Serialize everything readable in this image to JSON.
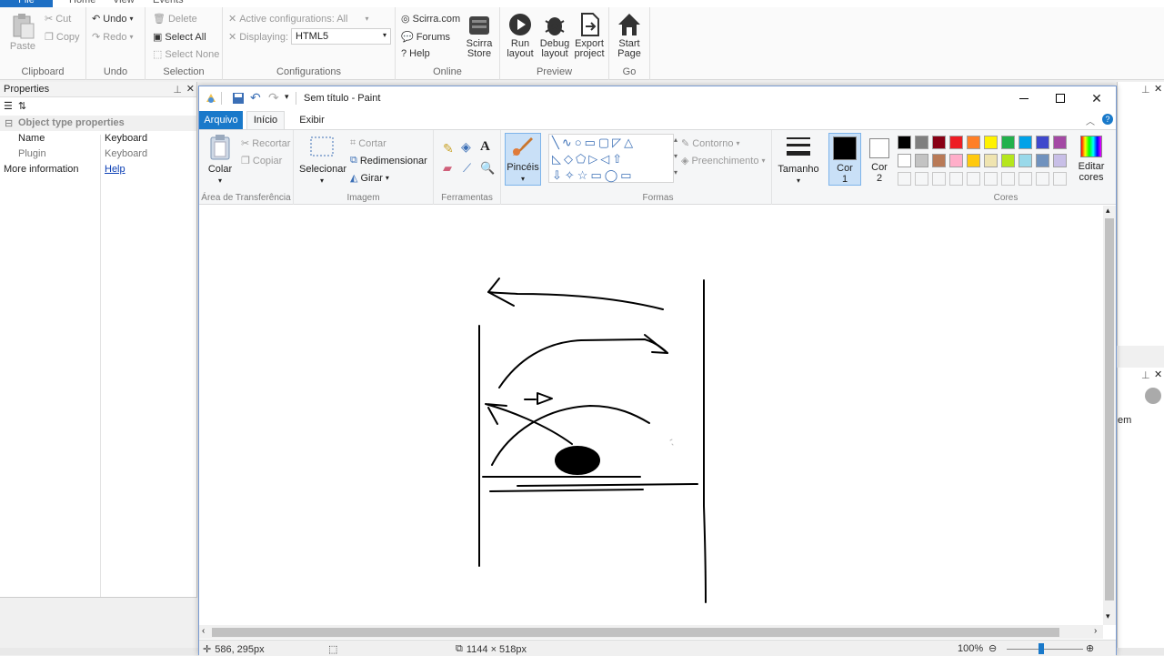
{
  "construct": {
    "tabs": [
      "File",
      "Home",
      "View",
      "Events"
    ],
    "clipboard": {
      "paste": "Paste",
      "cut": "Cut",
      "copy": "Copy",
      "label": "Clipboard"
    },
    "undo": {
      "undo": "Undo",
      "redo": "Redo",
      "label": "Undo"
    },
    "selection": {
      "delete": "Delete",
      "select_all": "Select All",
      "select_none": "Select None",
      "label": "Selection"
    },
    "configurations": {
      "active": "Active configurations: All",
      "displaying": "Displaying:",
      "displaying_value": "HTML5",
      "label": "Configurations"
    },
    "online": {
      "scirra": "Scirra.com",
      "forums": "Forums",
      "help": "Help",
      "store": "Scirra Store",
      "label": "Online"
    },
    "preview": {
      "run": "Run layout",
      "debug": "Debug layout",
      "export": "Export project",
      "label": "Preview"
    },
    "go": {
      "start": "Start Page",
      "label": "Go"
    },
    "properties": {
      "title": "Properties",
      "section": "Object type properties",
      "rows": [
        {
          "key": "Name",
          "value": "Keyboard"
        },
        {
          "key": "Plugin",
          "value": "Keyboard"
        }
      ],
      "more_info": "More information",
      "help_link": "Help"
    },
    "right_panel_text": "em"
  },
  "paint": {
    "title": "Sem título - Paint",
    "tabs": {
      "arquivo": "Arquivo",
      "inicio": "Início",
      "exibir": "Exibir"
    },
    "transfer": {
      "colar": "Colar",
      "recortar": "Recortar",
      "copiar": "Copiar",
      "label": "Área de Transferência"
    },
    "imagem": {
      "selecionar": "Selecionar",
      "cortar": "Cortar",
      "redimensionar": "Redimensionar",
      "girar": "Girar",
      "label": "Imagem"
    },
    "ferramentas": {
      "label": "Ferramentas"
    },
    "pinceis": "Pincéis",
    "formas": {
      "contorno": "Contorno",
      "preenchimento": "Preenchimento",
      "label": "Formas"
    },
    "tamanho": "Tamanho",
    "cor1": "Cor",
    "cor1_num": "1",
    "cor2": "Cor",
    "cor2_num": "2",
    "cores": {
      "label": "Cores",
      "editar": "Editar",
      "editar2": "cores"
    },
    "palette_row1": [
      "#000000",
      "#7f7f7f",
      "#880015",
      "#ed1c24",
      "#ff7f27",
      "#fff200",
      "#22b14c",
      "#00a2e8",
      "#3f48cc",
      "#a349a4"
    ],
    "palette_row2": [
      "#ffffff",
      "#c3c3c3",
      "#b97a57",
      "#ffaec9",
      "#ffc90e",
      "#efe4b0",
      "#b5e61d",
      "#99d9ea",
      "#7092be",
      "#c8bfe7"
    ],
    "status": {
      "cursor": "586, 295px",
      "size": "1144 × 518px",
      "zoom": "100%"
    }
  }
}
